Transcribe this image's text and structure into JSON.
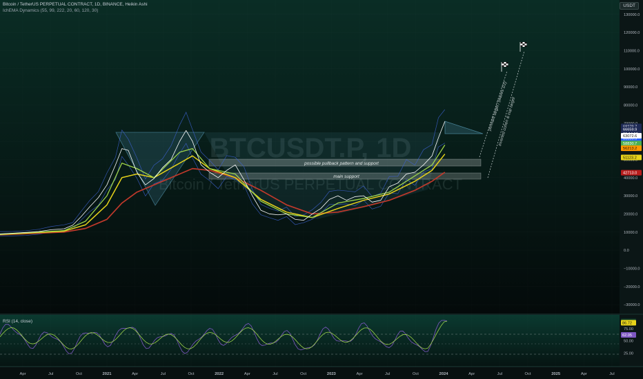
{
  "header": {
    "symbol_line": "Bitcoin / TetherUS PERPETUAL CONTRACT, 1D, BINANCE, Heikin Ashi",
    "indicator_line": "IchEMA Dynamics (55, 99, 222, 20, 60, 120, 30)",
    "currency": "USDT"
  },
  "watermark": {
    "ticker": "BTCUSDT.P, 1D",
    "name": "Bitcoin / TetherUS PERPETUAL CONTRACT"
  },
  "annotations": {
    "pullback_zone": "possible pullback pattern and support",
    "main_support": "main support",
    "target_1": "pennant target / (waves 1/2)",
    "target_2": "inverted cohen & cup target"
  },
  "rsi": {
    "title": "RSI (14, close)",
    "axis_ticks": [
      "75.00",
      "50.00",
      "25.00"
    ],
    "labels": [
      {
        "text": "89.70",
        "value": 89.7,
        "bg": "#0f3d2a",
        "fg": "#c9f2c0"
      },
      {
        "text": "86.72",
        "value": 86.72,
        "bg": "#e7d31a",
        "fg": "#1a1a1a"
      },
      {
        "text": "62.05",
        "value": 62.05,
        "bg": "#7e57c2",
        "fg": "#ffffff"
      }
    ]
  },
  "colors": {
    "background_top": "#0a2d25",
    "background_bottom": "#040a0a",
    "price_line": "#ffffff",
    "cloud_line": "#3f63d6",
    "ema_fast": "#9ed34a",
    "ema_mid": "#e7d31a",
    "ema_slow": "#c0392b",
    "rsi_line": "#7e57c2",
    "rsi_fast": "#9ed34a"
  },
  "chart_data": {
    "type": "line",
    "y_axis_ticks": [
      130000,
      120000,
      110000,
      100000,
      90000,
      80000,
      70000,
      60000,
      50000,
      40000,
      30000,
      20000,
      10000,
      0,
      -10000,
      -20000,
      -30000
    ],
    "y_axis_tick_labels": [
      "130000.0",
      "120000.0",
      "110000.0",
      "100000.0",
      "90000.0",
      "80000.0",
      "70000.0",
      "60000.0",
      "50000.0",
      "40000.0",
      "30000.0",
      "20000.0",
      "10000.0",
      "0.0",
      "−10000.0",
      "−20000.0",
      "−30000.0"
    ],
    "ylim": [
      -33000,
      136000
    ],
    "x_axis_labels": [
      "Apr",
      "Jul",
      "Oct",
      "2021",
      "Apr",
      "Jul",
      "Oct",
      "2022",
      "Apr",
      "Jul",
      "Oct",
      "2023",
      "Apr",
      "Jul",
      "Oct",
      "2024",
      "Apr",
      "Jul",
      "Oct",
      "2025",
      "Apr",
      "Jul"
    ],
    "x_axis_bold": [
      "2021",
      "2022",
      "2023",
      "2024",
      "2025"
    ],
    "price_labels": [
      {
        "text": "68279.7",
        "value": 68279.7,
        "bg": "#1e2a55",
        "fg": "#ffffff"
      },
      {
        "text": "66659.9",
        "value": 66659.9,
        "bg": "#1e2a55",
        "fg": "#ffffff"
      },
      {
        "text": "06:14:53",
        "value": 64200,
        "bg": "#1e2a55",
        "fg": "#ffffff"
      },
      {
        "text": "66659.9",
        "value": 61700,
        "bg": "#2962ff",
        "fg": "#ffffff"
      },
      {
        "text": "63072.6",
        "value": 63072.6,
        "bg": "#ffffff",
        "fg": "#111111"
      },
      {
        "text": "58830.7",
        "value": 58830.7,
        "bg": "#4caf50",
        "fg": "#ffffff"
      },
      {
        "text": "56213.2",
        "value": 56213.2,
        "bg": "#ff9800",
        "fg": "#111111"
      },
      {
        "text": "51123.2",
        "value": 51123.2,
        "bg": "#e7d31a",
        "fg": "#111111"
      },
      {
        "text": "42713.0",
        "value": 42713.0,
        "bg": "#b71c1c",
        "fg": "#ffffff"
      }
    ],
    "series": [
      {
        "name": "",
        "role": "price",
        "points": [
          [
            0,
            9000
          ],
          [
            6,
            9400
          ],
          [
            12,
            9800
          ],
          [
            18,
            10300
          ],
          [
            24,
            11300
          ],
          [
            30,
            11800
          ],
          [
            34,
            13800
          ],
          [
            38,
            18600
          ],
          [
            42,
            24000
          ],
          [
            46,
            29000
          ],
          [
            50,
            36000
          ],
          [
            54,
            47000
          ],
          [
            57,
            56000
          ],
          [
            60,
            55000
          ],
          [
            64,
            43000
          ],
          [
            68,
            36000
          ],
          [
            72,
            39500
          ],
          [
            76,
            45500
          ],
          [
            80,
            50000
          ],
          [
            84,
            60000
          ],
          [
            87,
            66000
          ],
          [
            90,
            60000
          ],
          [
            94,
            47000
          ],
          [
            98,
            43000
          ],
          [
            102,
            40000
          ],
          [
            106,
            44000
          ],
          [
            110,
            47000
          ],
          [
            114,
            39000
          ],
          [
            118,
            30000
          ],
          [
            122,
            22000
          ],
          [
            126,
            20000
          ],
          [
            130,
            19500
          ],
          [
            134,
            20000
          ],
          [
            138,
            17000
          ],
          [
            142,
            16500
          ],
          [
            146,
            20000
          ],
          [
            150,
            23000
          ],
          [
            154,
            28000
          ],
          [
            158,
            30000
          ],
          [
            162,
            27500
          ],
          [
            166,
            29500
          ],
          [
            170,
            30000
          ],
          [
            174,
            26500
          ],
          [
            178,
            27500
          ],
          [
            182,
            35000
          ],
          [
            186,
            37000
          ],
          [
            190,
            42000
          ],
          [
            194,
            43000
          ],
          [
            198,
            47000
          ],
          [
            202,
            52000
          ],
          [
            205,
            62000
          ],
          [
            208,
            71000
          ]
        ]
      },
      {
        "name": "",
        "role": "ema_fast",
        "points": [
          [
            0,
            8800
          ],
          [
            30,
            10800
          ],
          [
            40,
            16000
          ],
          [
            50,
            30000
          ],
          [
            57,
            48000
          ],
          [
            64,
            45000
          ],
          [
            72,
            40000
          ],
          [
            84,
            54000
          ],
          [
            90,
            56000
          ],
          [
            98,
            45000
          ],
          [
            110,
            42000
          ],
          [
            122,
            27000
          ],
          [
            134,
            20000
          ],
          [
            146,
            18000
          ],
          [
            158,
            26000
          ],
          [
            170,
            28500
          ],
          [
            182,
            32000
          ],
          [
            194,
            41000
          ],
          [
            202,
            47000
          ],
          [
            208,
            58000
          ]
        ]
      },
      {
        "name": "",
        "role": "ema_mid",
        "points": [
          [
            0,
            8700
          ],
          [
            30,
            10500
          ],
          [
            40,
            14000
          ],
          [
            50,
            25000
          ],
          [
            57,
            40000
          ],
          [
            64,
            42000
          ],
          [
            72,
            40000
          ],
          [
            84,
            48000
          ],
          [
            90,
            52000
          ],
          [
            98,
            45000
          ],
          [
            110,
            40000
          ],
          [
            122,
            28000
          ],
          [
            134,
            21000
          ],
          [
            146,
            18000
          ],
          [
            158,
            23000
          ],
          [
            170,
            27500
          ],
          [
            182,
            31000
          ],
          [
            194,
            38000
          ],
          [
            202,
            44000
          ],
          [
            208,
            53000
          ]
        ]
      },
      {
        "name": "",
        "role": "ema_slow",
        "points": [
          [
            0,
            8500
          ],
          [
            30,
            10000
          ],
          [
            40,
            12000
          ],
          [
            50,
            17000
          ],
          [
            57,
            26000
          ],
          [
            64,
            32000
          ],
          [
            72,
            36000
          ],
          [
            84,
            42000
          ],
          [
            90,
            45000
          ],
          [
            98,
            44000
          ],
          [
            110,
            40000
          ],
          [
            122,
            33000
          ],
          [
            134,
            25000
          ],
          [
            146,
            20000
          ],
          [
            158,
            21000
          ],
          [
            170,
            24000
          ],
          [
            182,
            27500
          ],
          [
            194,
            33000
          ],
          [
            202,
            38000
          ],
          [
            208,
            43000
          ]
        ]
      }
    ]
  }
}
